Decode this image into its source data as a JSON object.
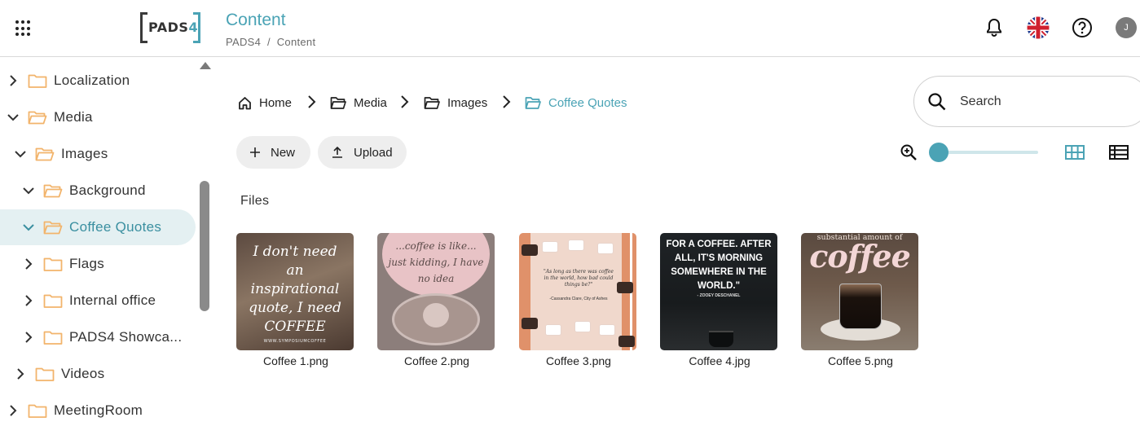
{
  "header": {
    "title": "Content",
    "breadcrumb": "PADS4  /  Content",
    "logo_text_a": "PADS",
    "logo_text_b": "4",
    "user_initial": "J",
    "accent_color": "#4ba3b5"
  },
  "sidebar": {
    "items": [
      {
        "label": "Localization",
        "expanded": false
      },
      {
        "label": "Media",
        "expanded": true
      },
      {
        "label": "Images",
        "expanded": true
      },
      {
        "label": "Background",
        "expanded": true
      },
      {
        "label": "Coffee Quotes",
        "expanded": true,
        "selected": true
      },
      {
        "label": "Flags",
        "expanded": false
      },
      {
        "label": "Internal office",
        "expanded": false
      },
      {
        "label": "PADS4 Showca...",
        "expanded": false
      },
      {
        "label": "Videos",
        "expanded": false
      },
      {
        "label": "MeetingRoom",
        "expanded": false
      }
    ]
  },
  "breadcrumb": {
    "items": [
      "Home",
      "Media",
      "Images",
      "Coffee Quotes"
    ]
  },
  "search": {
    "placeholder": "Search"
  },
  "toolbar": {
    "new_label": "New",
    "upload_label": "Upload"
  },
  "zoom": {
    "level": 0.0
  },
  "files": {
    "section_label": "Files",
    "items": [
      {
        "name": "Coffee 1.png",
        "thumb_text": "I don't need an inspirational quote, I need COFFEE",
        "thumb_small": "WWW.SYMPOSIUMCOFFEE"
      },
      {
        "name": "Coffee 2.png",
        "thumb_text": "...coffee is like... just kidding, I have no idea"
      },
      {
        "name": "Coffee 3.png",
        "thumb_text": "\"As long as there was coffee in the world, how bad could things be?\"",
        "thumb_author": "-Cassandra Clare, City of Ashes"
      },
      {
        "name": "Coffee 4.jpg",
        "thumb_text": "FOR A COFFEE. AFTER ALL, IT'S MORNING SOMEWHERE IN THE WORLD.\"",
        "thumb_author": "- ZOOEY DESCHANEL"
      },
      {
        "name": "Coffee 5.png",
        "thumb_top": "substantial amount of",
        "thumb_big": "coffee"
      }
    ]
  }
}
